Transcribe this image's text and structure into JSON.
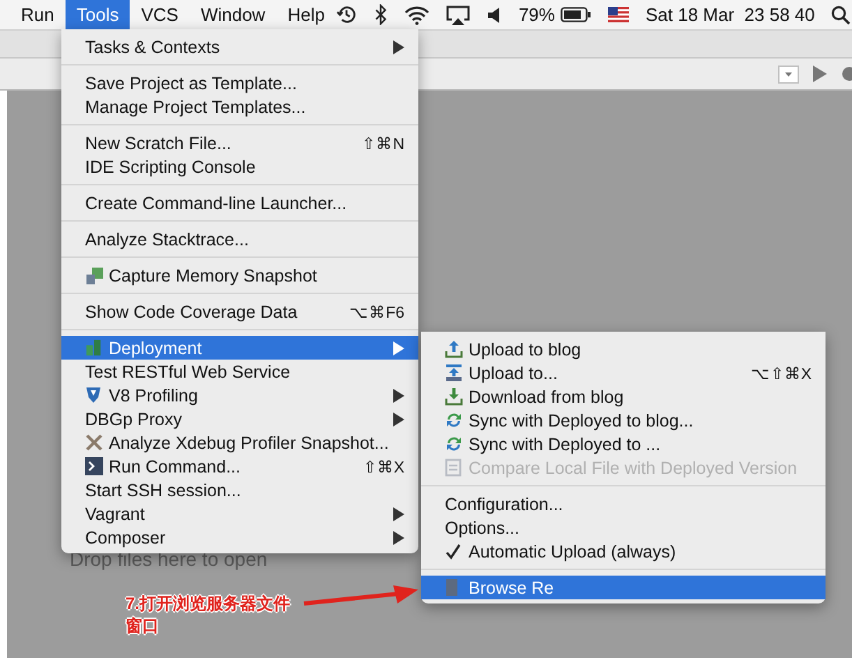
{
  "menu_bar": {
    "items": [
      {
        "label": "Run",
        "selected": false
      },
      {
        "label": "Tools",
        "selected": true
      },
      {
        "label": "VCS",
        "selected": false
      },
      {
        "label": "Window",
        "selected": false
      },
      {
        "label": "Help",
        "selected": false
      }
    ],
    "battery": "79%",
    "clock": "Sat 18 Mar  23 58 40"
  },
  "editor": {
    "drop_hint": "Drop files here to open"
  },
  "tools_menu": {
    "items": [
      {
        "kind": "item",
        "label": "Tasks & Contexts",
        "submenu": true,
        "selected": false
      },
      {
        "kind": "separator"
      },
      {
        "kind": "item",
        "label": "Save Project as Template...",
        "submenu": false,
        "selected": false
      },
      {
        "kind": "item",
        "label": "Manage Project Templates...",
        "submenu": false,
        "selected": false
      },
      {
        "kind": "separator"
      },
      {
        "kind": "item",
        "label": "New Scratch File...",
        "shortcut": "⇧⌘N",
        "submenu": false,
        "selected": false
      },
      {
        "kind": "item",
        "label": "IDE Scripting Console",
        "submenu": false,
        "selected": false
      },
      {
        "kind": "separator"
      },
      {
        "kind": "item",
        "label": "Create Command-line Launcher...",
        "submenu": false,
        "selected": false
      },
      {
        "kind": "separator"
      },
      {
        "kind": "item",
        "label": "Analyze Stacktrace...",
        "submenu": false,
        "selected": false
      },
      {
        "kind": "separator"
      },
      {
        "kind": "item",
        "label": "Capture Memory Snapshot",
        "submenu": false,
        "selected": false
      },
      {
        "kind": "separator"
      },
      {
        "kind": "item",
        "label": "Show Code Coverage Data",
        "shortcut": "⌥⌘F6",
        "submenu": false,
        "selected": false
      },
      {
        "kind": "separator"
      },
      {
        "kind": "item",
        "label": "Deployment",
        "submenu": true,
        "selected": true
      },
      {
        "kind": "item",
        "label": "Test RESTful Web Service",
        "submenu": false,
        "selected": false
      },
      {
        "kind": "item",
        "label": "V8 Profiling",
        "submenu": true,
        "selected": false
      },
      {
        "kind": "item",
        "label": "DBGp Proxy",
        "submenu": true,
        "selected": false
      },
      {
        "kind": "item",
        "label": "Analyze Xdebug Profiler Snapshot...",
        "submenu": false,
        "selected": false
      },
      {
        "kind": "item",
        "label": "Run Command...",
        "shortcut": "⇧⌘X",
        "submenu": false,
        "selected": false
      },
      {
        "kind": "item",
        "label": "Start SSH session...",
        "submenu": false,
        "selected": false
      },
      {
        "kind": "item",
        "label": "Vagrant",
        "submenu": true,
        "selected": false
      },
      {
        "kind": "item",
        "label": "Composer",
        "submenu": true,
        "selected": false
      }
    ]
  },
  "deployment_submenu": {
    "items": [
      {
        "kind": "item",
        "label": "Upload to blog",
        "selected": false,
        "disabled": false,
        "checked": false
      },
      {
        "kind": "item",
        "label": "Upload to...",
        "shortcut": "⌥⇧⌘X",
        "selected": false,
        "disabled": false,
        "checked": false
      },
      {
        "kind": "item",
        "label": "Download from blog",
        "selected": false,
        "disabled": false,
        "checked": false
      },
      {
        "kind": "item",
        "label": "Sync with Deployed to blog...",
        "selected": false,
        "disabled": false,
        "checked": false
      },
      {
        "kind": "item",
        "label": "Sync with Deployed to ...",
        "selected": false,
        "disabled": false,
        "checked": false
      },
      {
        "kind": "item",
        "label": "Compare Local File with Deployed Version",
        "selected": false,
        "disabled": true,
        "checked": false
      },
      {
        "kind": "separator"
      },
      {
        "kind": "item",
        "label": "Configuration...",
        "selected": false,
        "disabled": false,
        "checked": false
      },
      {
        "kind": "item",
        "label": "Options...",
        "selected": false,
        "disabled": false,
        "checked": false
      },
      {
        "kind": "item",
        "label": "Automatic Upload (always)",
        "selected": false,
        "disabled": false,
        "checked": true
      },
      {
        "kind": "separator"
      },
      {
        "kind": "item",
        "label": "Browse Re",
        "selected": true,
        "disabled": false,
        "checked": false
      }
    ]
  },
  "callout": {
    "text": "7.打开浏览服务器文件窗口"
  }
}
